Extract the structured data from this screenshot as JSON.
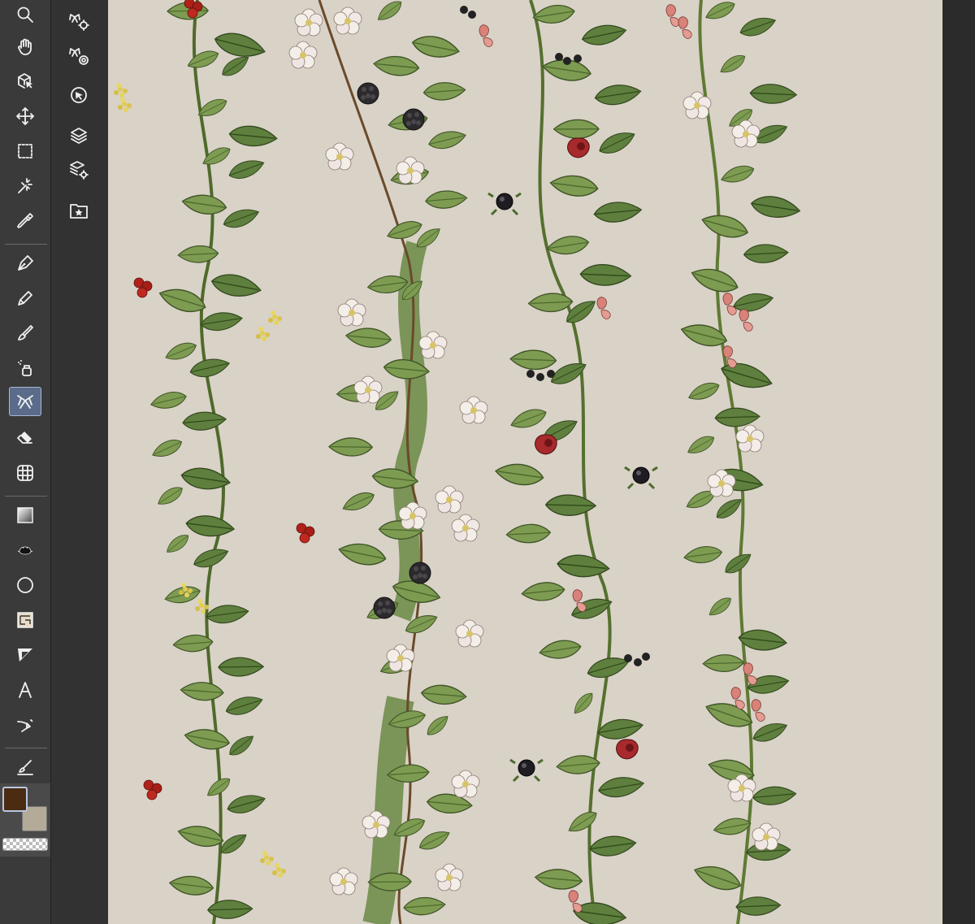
{
  "tools": [
    {
      "name": "zoom-tool",
      "icon": "magnifier-icon"
    },
    {
      "name": "hand-tool",
      "icon": "hand-icon"
    },
    {
      "name": "operation-tool",
      "icon": "object-select-icon"
    },
    {
      "name": "move-tool",
      "icon": "move-arrows-icon"
    },
    {
      "name": "selection-tool",
      "icon": "marquee-icon"
    },
    {
      "name": "auto-select-tool",
      "icon": "magic-wand-icon"
    },
    {
      "name": "eyedropper-tool",
      "icon": "eyedropper-icon"
    },
    {
      "name": "pen-tool",
      "icon": "pen-nib-icon"
    },
    {
      "name": "pencil-tool",
      "icon": "pencil-icon"
    },
    {
      "name": "brush-tool",
      "icon": "brush-icon"
    },
    {
      "name": "airbrush-tool",
      "icon": "airbrush-icon"
    },
    {
      "name": "decoration-tool",
      "icon": "ribbon-icon"
    },
    {
      "name": "eraser-tool",
      "icon": "eraser-icon"
    },
    {
      "name": "blend-tool",
      "icon": "blend-grid-icon"
    },
    {
      "name": "gradient-tool",
      "icon": "gradient-icon"
    },
    {
      "name": "fill-tool",
      "icon": "fill-splat-icon"
    },
    {
      "name": "figure-tool",
      "icon": "circle-icon"
    },
    {
      "name": "frame-border-tool",
      "icon": "frame-icon"
    },
    {
      "name": "balloon-tool",
      "icon": "balloon-icon"
    },
    {
      "name": "text-tool",
      "icon": "text-A-icon"
    },
    {
      "name": "correct-line-tool",
      "icon": "correct-line-icon"
    },
    {
      "name": "ruler-tool",
      "icon": "brush-ruler-icon"
    }
  ],
  "sub_tools": [
    {
      "name": "sub-tool-decoration-settings",
      "icon": "ribbon-gear-icon"
    },
    {
      "name": "sub-tool-decoration-target",
      "icon": "ribbon-target-icon"
    },
    {
      "name": "sub-tool-object-select",
      "icon": "circle-cursor-icon"
    },
    {
      "name": "sub-tool-layers",
      "icon": "layers-icon"
    },
    {
      "name": "sub-tool-layer-options",
      "icon": "layers-cog-icon"
    },
    {
      "name": "sub-tool-favorites",
      "icon": "folder-star-icon"
    }
  ],
  "active_tool": "decoration-tool",
  "colors": {
    "main": "#4a2c12",
    "sub": "#b3aa98",
    "canvas_bg": "#d9d2c7",
    "active_tool_bg": "#5b6c8a"
  }
}
